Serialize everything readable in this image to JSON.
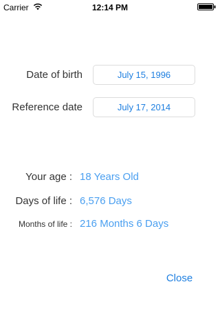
{
  "status_bar": {
    "carrier": "Carrier",
    "time": "12:14 PM",
    "wifi_icon": "wifi-icon",
    "battery_icon": "battery-icon"
  },
  "form": {
    "birth_label": "Date of birth",
    "birth_value": "July 15, 1996",
    "reference_label": "Reference date",
    "reference_value": "July 17, 2014"
  },
  "results": {
    "age_label": "Your age :",
    "age_value": "18 Years Old",
    "days_label": "Days of life :",
    "days_value": "6,576 Days",
    "months_label": "Months of life :",
    "months_value": "216 Months 6 Days"
  },
  "actions": {
    "close_label": "Close"
  },
  "colors": {
    "accent": "#1e7fe0",
    "result_value": "#4a9ff0",
    "label": "#333333",
    "border": "#dcdcdc"
  }
}
